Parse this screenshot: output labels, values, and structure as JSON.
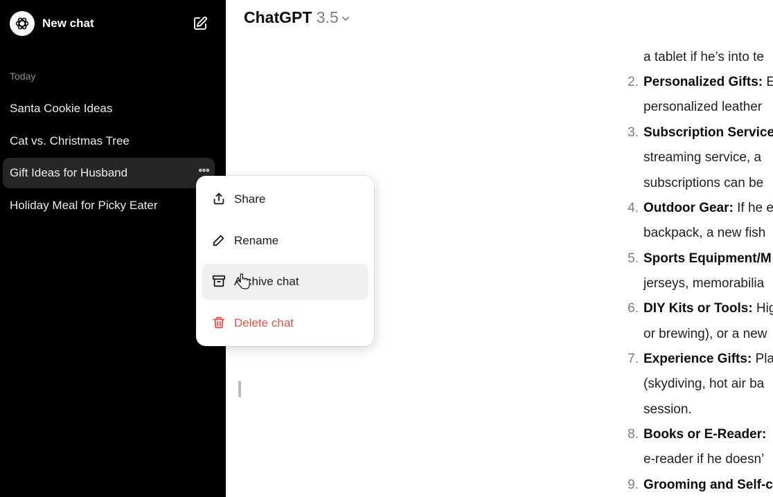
{
  "app": {
    "title": "ChatGPT",
    "version": "3.5"
  },
  "sidebar": {
    "new_chat_label": "New chat",
    "section_label": "Today",
    "items": [
      {
        "label": "Santa Cookie Ideas"
      },
      {
        "label": "Cat vs. Christmas Tree"
      },
      {
        "label": "Gift Ideas for Husband"
      },
      {
        "label": "Holiday Meal for Picky Eater"
      }
    ]
  },
  "context_menu": {
    "items": [
      {
        "label": "Share",
        "icon": "share-icon"
      },
      {
        "label": "Rename",
        "icon": "pencil-icon"
      },
      {
        "label": "Archive chat",
        "icon": "archive-icon"
      },
      {
        "label": "Delete chat",
        "icon": "trash-icon"
      }
    ]
  },
  "content": {
    "lines": [
      {
        "text": "a tablet if he’s into te"
      },
      {
        "num": "2.",
        "bold": "Personalized Gifts:",
        "text": " E"
      },
      {
        "text": "personalized leather"
      },
      {
        "num": "3.",
        "bold": "Subscription Service",
        "text": ""
      },
      {
        "text": "streaming service, a"
      },
      {
        "text": "subscriptions can be"
      },
      {
        "num": "4.",
        "bold": "Outdoor Gear:",
        "text": " If he e"
      },
      {
        "text": "backpack, a new fish"
      },
      {
        "num": "5.",
        "bold": "Sports Equipment/M",
        "text": ""
      },
      {
        "text": "jerseys, memorabilia"
      },
      {
        "num": "6.",
        "bold": "DIY Kits or Tools:",
        "text": " Hig"
      },
      {
        "text": "or brewing), or a new"
      },
      {
        "num": "7.",
        "bold": "Experience Gifts:",
        "text": " Pla"
      },
      {
        "text": "(skydiving, hot air ba"
      },
      {
        "text": "session."
      },
      {
        "num": "8.",
        "bold": "Books or E-Reader:",
        "text": " "
      },
      {
        "text": "e-reader if he doesn’"
      },
      {
        "num": "9.",
        "bold": "Grooming and Self-c",
        "text": ""
      }
    ]
  },
  "colors": {
    "sidebar_bg": "#000000",
    "active_item_bg": "#262626",
    "danger": "#e0524a"
  }
}
